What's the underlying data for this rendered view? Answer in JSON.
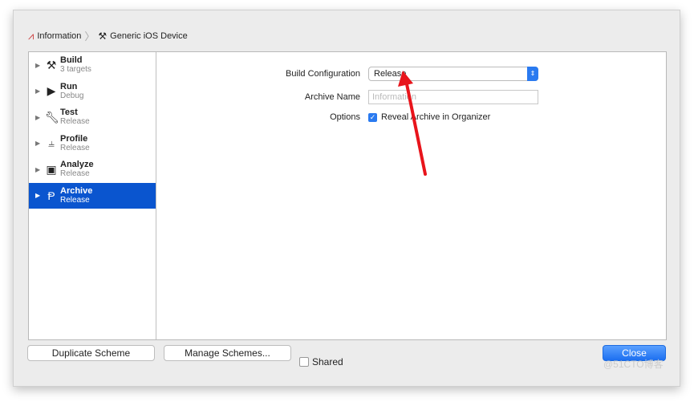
{
  "breadcrumb": {
    "project": "Information",
    "device": "Generic iOS Device"
  },
  "sidebar": {
    "items": [
      {
        "label": "Build",
        "sub": "3 targets",
        "icon": "hammer-icon"
      },
      {
        "label": "Run",
        "sub": "Debug",
        "icon": "play-icon"
      },
      {
        "label": "Test",
        "sub": "Release",
        "icon": "wrench-icon"
      },
      {
        "label": "Profile",
        "sub": "Release",
        "icon": "instruments-icon"
      },
      {
        "label": "Analyze",
        "sub": "Release",
        "icon": "analyze-icon"
      },
      {
        "label": "Archive",
        "sub": "Release",
        "icon": "archive-icon",
        "selected": true
      }
    ]
  },
  "form": {
    "build_config_label": "Build Configuration",
    "build_config_value": "Release",
    "archive_name_label": "Archive Name",
    "archive_name_placeholder": "Information",
    "options_label": "Options",
    "reveal_label": "Reveal Archive in Organizer",
    "reveal_checked": true
  },
  "footer": {
    "duplicate": "Duplicate Scheme",
    "manage": "Manage Schemes...",
    "shared": "Shared",
    "shared_checked": false,
    "close": "Close"
  },
  "watermark": "@51CTO博客",
  "colors": {
    "accent": "#0a55cf",
    "arrow": "#e8141b"
  }
}
